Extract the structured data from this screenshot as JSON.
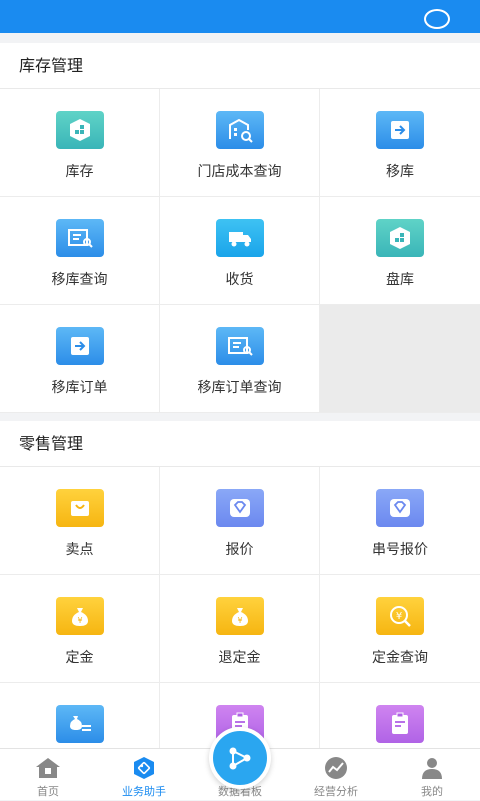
{
  "sections": [
    {
      "title": "库存管理",
      "items": [
        {
          "label": "库存",
          "icon": "inventory-box-icon",
          "color": "#3ab5b8"
        },
        {
          "label": "门店成本查询",
          "icon": "store-cost-query-icon",
          "color": "#2c8de8"
        },
        {
          "label": "移库",
          "icon": "transfer-icon",
          "color": "#2c8de8"
        },
        {
          "label": "移库查询",
          "icon": "transfer-query-icon",
          "color": "#2c8de8"
        },
        {
          "label": "收货",
          "icon": "delivery-truck-icon",
          "color": "#1aa4ea"
        },
        {
          "label": "盘库",
          "icon": "stocktake-box-icon",
          "color": "#3ab5b8"
        },
        {
          "label": "移库订单",
          "icon": "transfer-order-icon",
          "color": "#2c8de8"
        },
        {
          "label": "移库订单查询",
          "icon": "transfer-order-query-icon",
          "color": "#2c8de8"
        }
      ]
    },
    {
      "title": "零售管理",
      "items": [
        {
          "label": "卖点",
          "icon": "shopping-bag-icon",
          "color": "#f6b511"
        },
        {
          "label": "报价",
          "icon": "quote-diamond-icon",
          "color": "#6b88ef"
        },
        {
          "label": "串号报价",
          "icon": "serial-quote-diamond-icon",
          "color": "#6b88ef"
        },
        {
          "label": "定金",
          "icon": "deposit-moneybag-icon",
          "color": "#f6b511"
        },
        {
          "label": "退定金",
          "icon": "refund-deposit-moneybag-icon",
          "color": "#f6b511"
        },
        {
          "label": "定金查询",
          "icon": "deposit-query-icon",
          "color": "#f6b511"
        },
        {
          "label": "",
          "icon": "money-hand-icon",
          "color": "#2c8de8"
        },
        {
          "label": "",
          "icon": "clipboard-edit-icon",
          "color": "#b063e6"
        },
        {
          "label": "",
          "icon": "clipboard-check-icon",
          "color": "#b063e6"
        }
      ]
    }
  ],
  "nav": {
    "items": [
      {
        "label": "首页",
        "icon": "home-icon",
        "active": false
      },
      {
        "label": "业务助手",
        "icon": "assistant-tag-icon",
        "active": true
      },
      {
        "label": "数据看板",
        "icon": "dashboard-share-icon",
        "active": false
      },
      {
        "label": "经营分析",
        "icon": "analysis-chart-icon",
        "active": false
      },
      {
        "label": "我的",
        "icon": "profile-person-icon",
        "active": false
      }
    ]
  },
  "colors": {
    "accent": "#1a8bf0"
  }
}
